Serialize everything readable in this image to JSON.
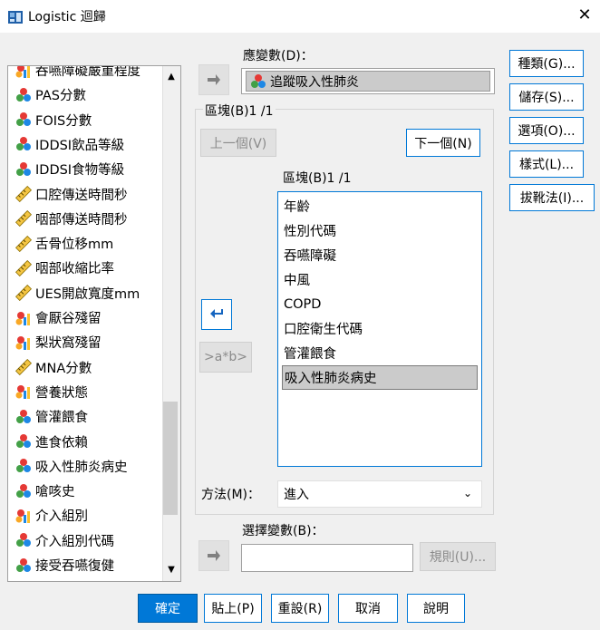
{
  "window": {
    "title": "Logistic 迴歸"
  },
  "variables": [
    {
      "label": "吞嚥障礙嚴重程度",
      "icon": "nominal-bar-icon"
    },
    {
      "label": "PAS分數",
      "icon": "ordinal-icon"
    },
    {
      "label": "FOIS分數",
      "icon": "ordinal-icon"
    },
    {
      "label": "IDDSI飲品等級",
      "icon": "ordinal-icon"
    },
    {
      "label": "IDDSI食物等級",
      "icon": "ordinal-icon"
    },
    {
      "label": "口腔傳送時間秒",
      "icon": "scale-ruler-icon"
    },
    {
      "label": "咽部傳送時間秒",
      "icon": "scale-ruler-icon"
    },
    {
      "label": "舌骨位移mm",
      "icon": "scale-ruler-icon"
    },
    {
      "label": "咽部收縮比率",
      "icon": "scale-ruler-icon"
    },
    {
      "label": "UES開啟寬度mm",
      "icon": "scale-ruler-icon"
    },
    {
      "label": "會厭谷殘留",
      "icon": "nominal-bar-icon"
    },
    {
      "label": "梨狀窩殘留",
      "icon": "nominal-bar-icon"
    },
    {
      "label": "MNA分數",
      "icon": "scale-ruler-icon"
    },
    {
      "label": "營養狀態",
      "icon": "nominal-bar-icon"
    },
    {
      "label": "管灌餵食",
      "icon": "ordinal-icon"
    },
    {
      "label": "進食依賴",
      "icon": "ordinal-icon"
    },
    {
      "label": "吸入性肺炎病史",
      "icon": "ordinal-icon"
    },
    {
      "label": "嗆咳史",
      "icon": "ordinal-icon"
    },
    {
      "label": "介入組別",
      "icon": "nominal-bar-icon"
    },
    {
      "label": "介入組別代碼",
      "icon": "ordinal-icon"
    },
    {
      "label": "接受吞嚥復健",
      "icon": "ordinal-icon"
    }
  ],
  "dependent": {
    "label": "應變數(D)：",
    "value": "追蹤吸入性肺炎"
  },
  "block": {
    "title": "區塊(B)1 /1",
    "prev_label": "上一個(V)",
    "next_label": "下一個(N)",
    "covariates_label": "區塊(B)1 /1",
    "interaction_label": ">a*b>",
    "covariates": [
      "年齡",
      "性別代碼",
      "吞嚥障礙",
      "中風",
      "COPD",
      "口腔衛生代碼",
      "管灌餵食",
      "吸入性肺炎病史"
    ],
    "selected_index": 7
  },
  "method": {
    "label": "方法(M)：",
    "value": "進入"
  },
  "selection": {
    "label": "選擇變數(B)：",
    "value": "",
    "rule_label": "規則(U)..."
  },
  "side_buttons": [
    "種類(G)...",
    "儲存(S)...",
    "選項(O)...",
    "樣式(L)...",
    "拔靴法(I)..."
  ],
  "bottom_buttons": [
    "確定",
    "貼上(P)",
    "重設(R)",
    "取消",
    "說明"
  ]
}
